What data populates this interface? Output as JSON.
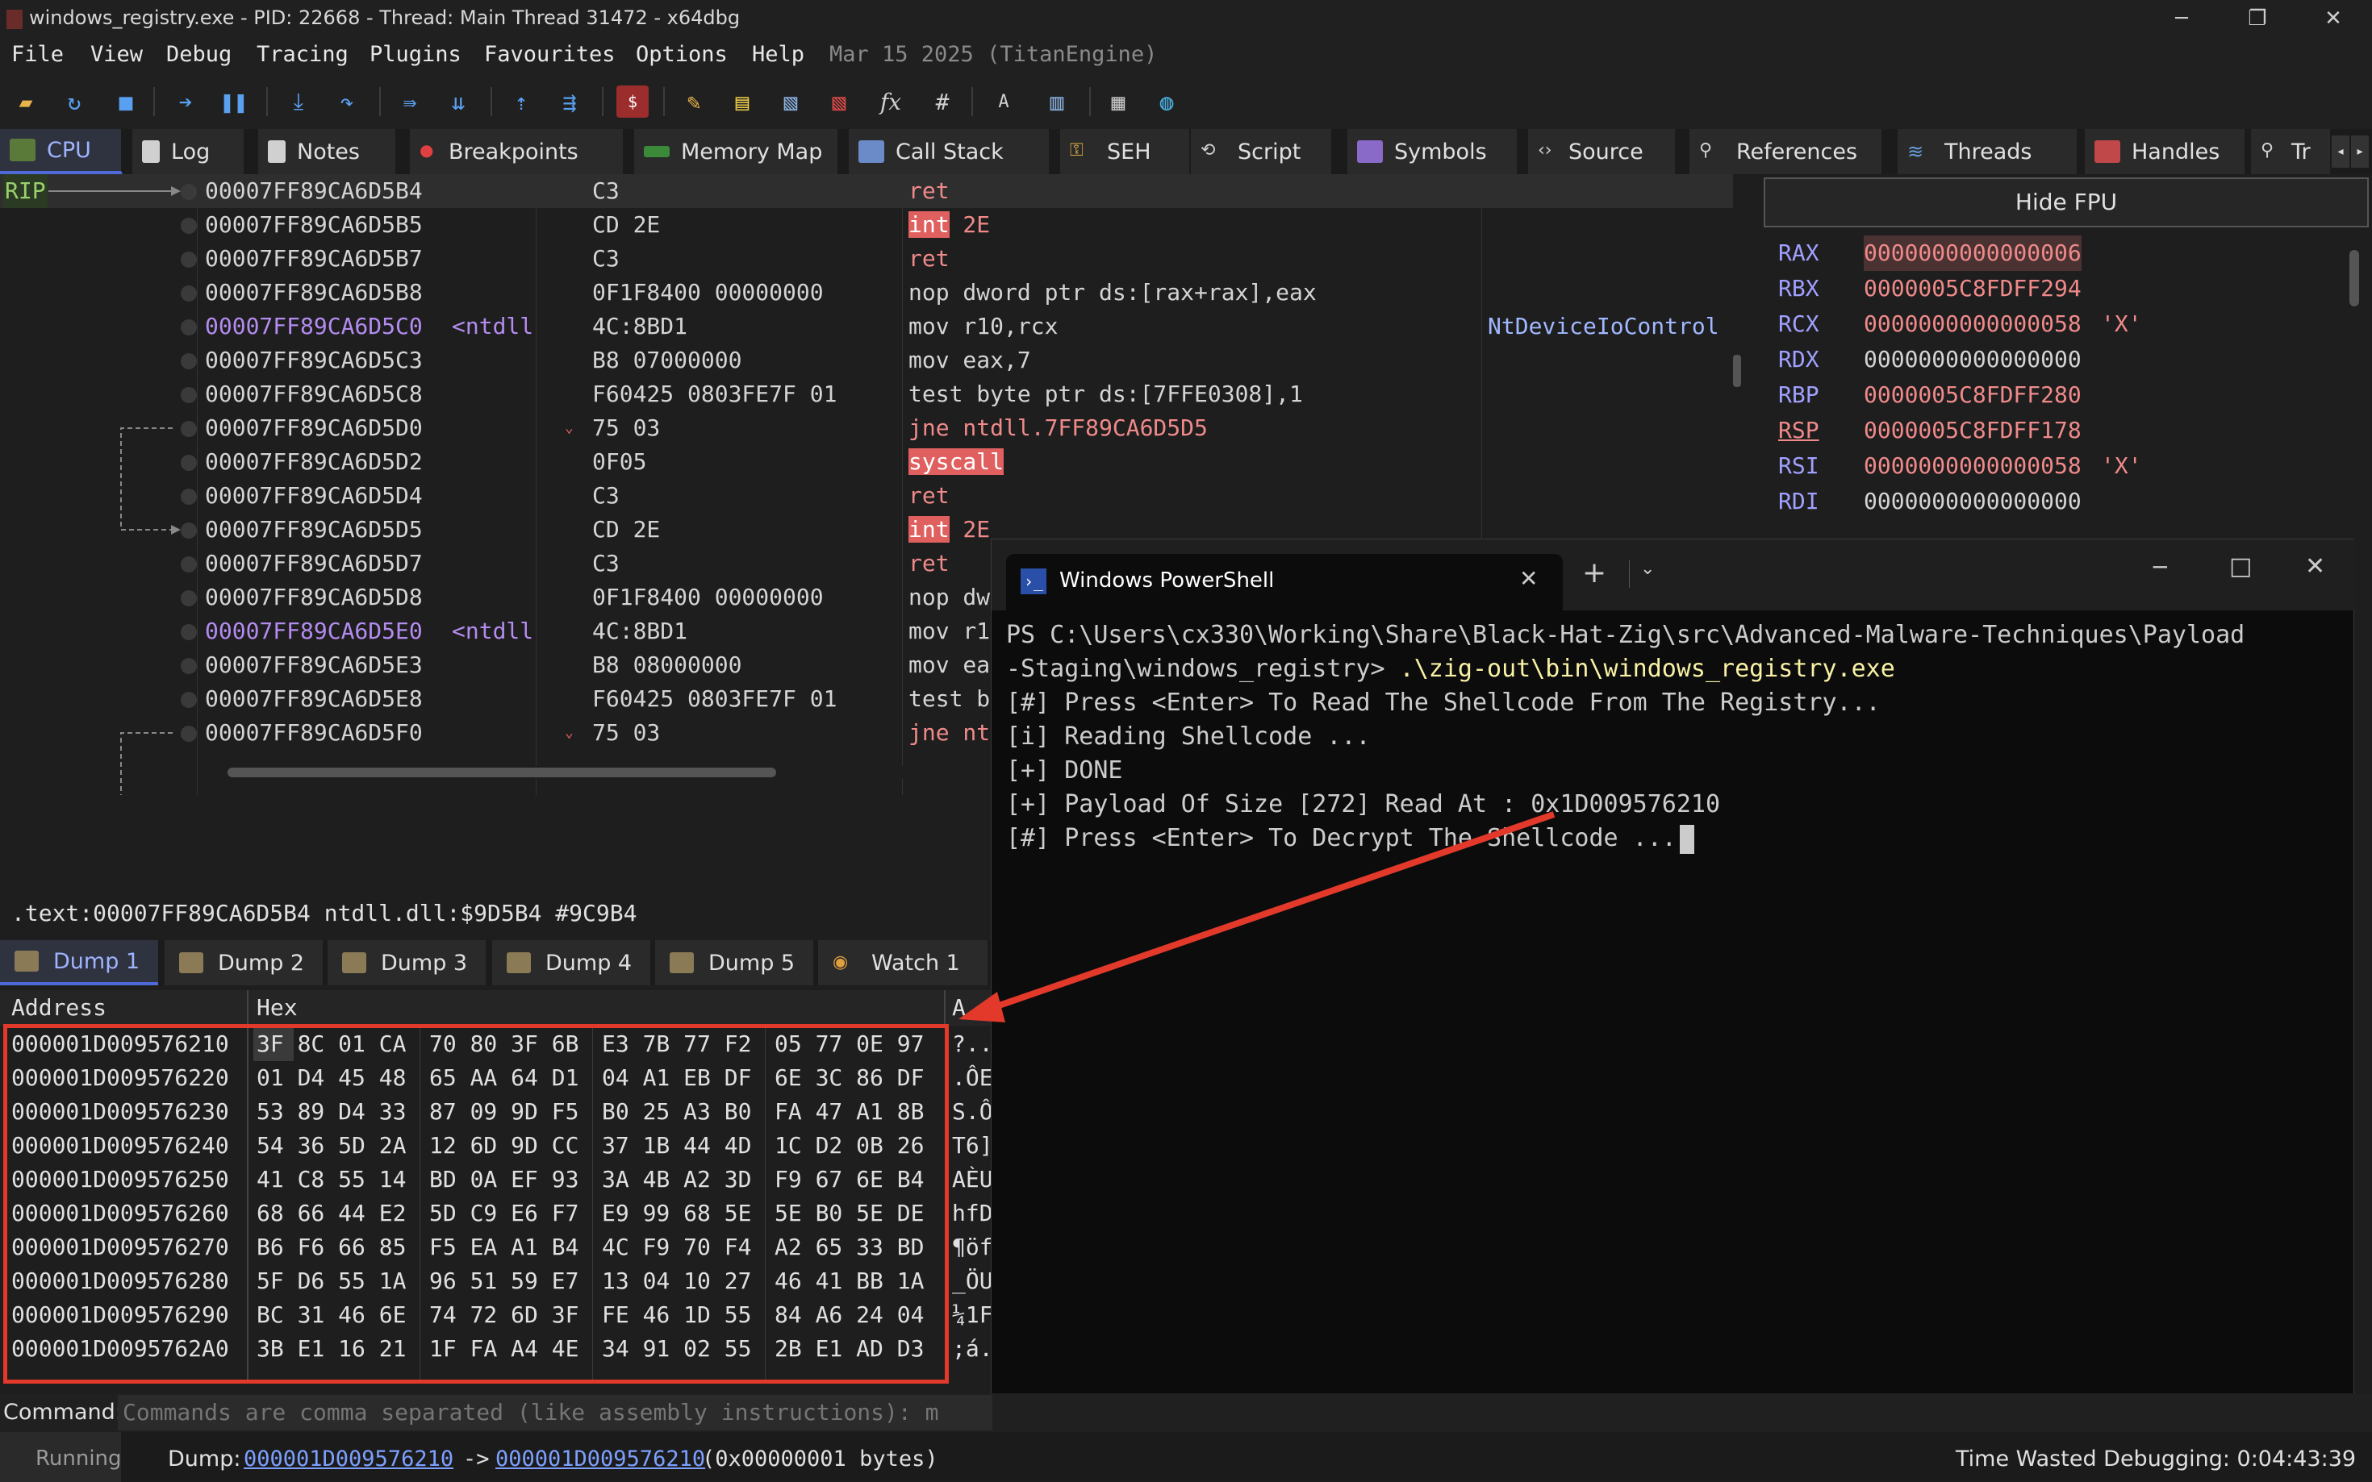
{
  "window": {
    "title": "windows_registry.exe - PID: 22668 - Thread: Main Thread 31472 - x64dbg",
    "controls": {
      "minimize": "─",
      "maximize": "❐",
      "close": "✕"
    }
  },
  "menu": {
    "items": [
      "File",
      "View",
      "Debug",
      "Tracing",
      "Plugins",
      "Favourites",
      "Options",
      "Help"
    ],
    "date": "Mar 15 2025 (TitanEngine)"
  },
  "tabs": [
    "CPU",
    "Log",
    "Notes",
    "Breakpoints",
    "Memory Map",
    "Call Stack",
    "SEH",
    "Script",
    "Symbols",
    "Source",
    "References",
    "Threads",
    "Handles",
    "Tr"
  ],
  "disasm": {
    "rip_label": "RIP",
    "rows": [
      {
        "addr": "00007FF89CA6D5B4",
        "label": "",
        "bytes": "C3",
        "instr": "ret",
        "comment": ""
      },
      {
        "addr": "00007FF89CA6D5B5",
        "label": "",
        "bytes": "CD 2E",
        "instr_hl": "int",
        "instr_rest": " 2E",
        "comment": ""
      },
      {
        "addr": "00007FF89CA6D5B7",
        "label": "",
        "bytes": "C3",
        "instr": "ret",
        "comment": ""
      },
      {
        "addr": "00007FF89CA6D5B8",
        "label": "",
        "bytes": "0F1F8400 00000000",
        "instr": "nop dword ptr ds:[rax+rax],eax",
        "comment": ""
      },
      {
        "addr": "00007FF89CA6D5C0",
        "label": "<ntdll",
        "bytes": "4C:8BD1",
        "instr": "mov r10,rcx",
        "comment": "NtDeviceIoControl"
      },
      {
        "addr": "00007FF89CA6D5C3",
        "label": "",
        "bytes": "B8 07000000",
        "instr": "mov eax,7",
        "comment": ""
      },
      {
        "addr": "00007FF89CA6D5C8",
        "label": "",
        "bytes": "F60425 0803FE7F 01",
        "instr": "test byte ptr ds:[7FFE0308],1",
        "comment": ""
      },
      {
        "addr": "00007FF89CA6D5D0",
        "label": "",
        "bytes": "75 03",
        "instr": "jne ntdll.7FF89CA6D5D5",
        "comment": ""
      },
      {
        "addr": "00007FF89CA6D5D2",
        "label": "",
        "bytes": "0F05",
        "instr_hl": "syscall",
        "instr_rest": "",
        "comment": ""
      },
      {
        "addr": "00007FF89CA6D5D4",
        "label": "",
        "bytes": "C3",
        "instr": "ret",
        "comment": ""
      },
      {
        "addr": "00007FF89CA6D5D5",
        "label": "",
        "bytes": "CD 2E",
        "instr_hl": "int",
        "instr_rest": " 2E",
        "comment": ""
      },
      {
        "addr": "00007FF89CA6D5D7",
        "label": "",
        "bytes": "C3",
        "instr": "ret",
        "comment": ""
      },
      {
        "addr": "00007FF89CA6D5D8",
        "label": "",
        "bytes": "0F1F8400 00000000",
        "instr": "nop dw",
        "comment": ""
      },
      {
        "addr": "00007FF89CA6D5E0",
        "label": "<ntdll",
        "bytes": "4C:8BD1",
        "instr": "mov r1",
        "comment": ""
      },
      {
        "addr": "00007FF89CA6D5E3",
        "label": "",
        "bytes": "B8 08000000",
        "instr": "mov ea",
        "comment": ""
      },
      {
        "addr": "00007FF89CA6D5E8",
        "label": "",
        "bytes": "F60425 0803FE7F 01",
        "instr": "test b",
        "comment": ""
      },
      {
        "addr": "00007FF89CA6D5F0",
        "label": "",
        "bytes": "75 03",
        "instr": "jne nt",
        "comment": ""
      }
    ]
  },
  "registers": {
    "hide_fpu": "Hide FPU",
    "rows": [
      {
        "name": "RAX",
        "value": "0000000000000006",
        "char": ""
      },
      {
        "name": "RBX",
        "value": "0000005C8FDFF294",
        "char": ""
      },
      {
        "name": "RCX",
        "value": "0000000000000058",
        "char": "'X'"
      },
      {
        "name": "RDX",
        "value": "0000000000000000",
        "char": ""
      },
      {
        "name": "RBP",
        "value": "0000005C8FDFF280",
        "char": ""
      },
      {
        "name": "RSP",
        "value": "0000005C8FDFF178",
        "char": ""
      },
      {
        "name": "RSI",
        "value": "0000000000000058",
        "char": "'X'"
      },
      {
        "name": "RDI",
        "value": "0000000000000000",
        "char": ""
      }
    ]
  },
  "info_line": ".text:00007FF89CA6D5B4 ntdll.dll:$9D5B4 #9C9B4",
  "dump_tabs": [
    "Dump 1",
    "Dump 2",
    "Dump 3",
    "Dump 4",
    "Dump 5",
    "Watch 1"
  ],
  "dump": {
    "header": {
      "address": "Address",
      "hex": "Hex",
      "ascii": "A"
    },
    "rows": [
      {
        "addr": "000001D009576210",
        "hex": [
          "3F 8C 01 CA",
          "70 80 3F 6B",
          "E3 7B 77 F2",
          "05 77 0E 97"
        ],
        "ascii": "?.."
      },
      {
        "addr": "000001D009576220",
        "hex": [
          "01 D4 45 48",
          "65 AA 64 D1",
          "04 A1 EB DF",
          "6E 3C 86 DF"
        ],
        "ascii": ".ÔE"
      },
      {
        "addr": "000001D009576230",
        "hex": [
          "53 89 D4 33",
          "87 09 9D F5",
          "B0 25 A3 B0",
          "FA 47 A1 8B"
        ],
        "ascii": "S.Ô"
      },
      {
        "addr": "000001D009576240",
        "hex": [
          "54 36 5D 2A",
          "12 6D 9D CC",
          "37 1B 44 4D",
          "1C D2 0B 26"
        ],
        "ascii": "T6]"
      },
      {
        "addr": "000001D009576250",
        "hex": [
          "41 C8 55 14",
          "BD 0A EF 93",
          "3A 4B A2 3D",
          "F9 67 6E B4"
        ],
        "ascii": "AÈU"
      },
      {
        "addr": "000001D009576260",
        "hex": [
          "68 66 44 E2",
          "5D C9 E6 F7",
          "E9 99 68 5E",
          "5E B0 5E DE"
        ],
        "ascii": "hfD"
      },
      {
        "addr": "000001D009576270",
        "hex": [
          "B6 F6 66 85",
          "F5 EA A1 B4",
          "4C F9 70 F4",
          "A2 65 33 BD"
        ],
        "ascii": "¶öf"
      },
      {
        "addr": "000001D009576280",
        "hex": [
          "5F D6 55 1A",
          "96 51 59 E7",
          "13 04 10 27",
          "46 41 BB 1A"
        ],
        "ascii": "_ÖU"
      },
      {
        "addr": "000001D009576290",
        "hex": [
          "BC 31 46 6E",
          "74 72 6D 3F",
          "FE 46 1D 55",
          "84 A6 24 04"
        ],
        "ascii": "¼1F"
      },
      {
        "addr": "000001D0095762A0",
        "hex": [
          "3B E1 16 21",
          "1F FA A4 4E",
          "34 91 02 55",
          "2B E1 AD D3"
        ],
        "ascii": ";á."
      }
    ]
  },
  "command": {
    "label": "Command:",
    "placeholder": "Commands are comma separated (like assembly instructions): m"
  },
  "status": {
    "state": "Running",
    "dump_prefix": "Dump:",
    "dump_from": "000001D009576210",
    "arrow": "->",
    "dump_to": "000001D009576210",
    "dump_size": "(0x00000001 bytes)",
    "time_wasted": "Time Wasted Debugging: 0:04:43:39"
  },
  "powershell": {
    "tab_title": "Windows PowerShell",
    "lines": [
      {
        "text": "PS C:\\Users\\cx330\\Working\\Share\\Black-Hat-Zig\\src\\Advanced-Malware-Techniques\\Payload"
      },
      {
        "text": "-Staging\\windows_registry> ",
        "cmd": ".\\zig-out\\bin\\windows_registry.exe"
      },
      {
        "text": "[#] Press <Enter> To Read The Shellcode From The Registry..."
      },
      {
        "text": "[i] Reading Shellcode ..."
      },
      {
        "text": "[+] DONE"
      },
      {
        "text": "[+] Payload Of Size [272] Read At : 0x1D009576210"
      },
      {
        "text": "[#] Press <Enter> To Decrypt The Shellcode ..."
      }
    ]
  },
  "colors": {
    "accent": "#4f6ad8",
    "highlight_red": "#e06060",
    "annotation_red": "#e2392b",
    "register_red": "#f08a8a",
    "label_purple": "#b48cf0"
  }
}
